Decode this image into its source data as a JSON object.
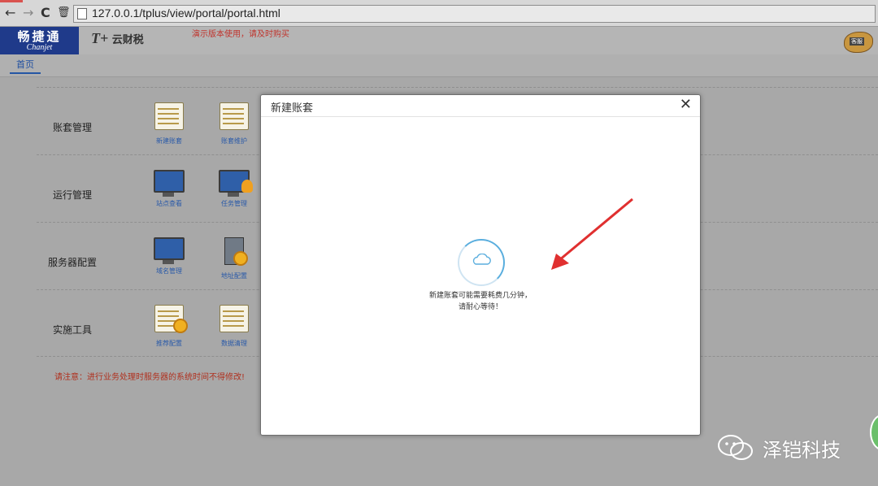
{
  "browser": {
    "url": "127.0.0.1/tplus/view/portal/portal.html",
    "back": "←",
    "forward": "→",
    "reload": "C",
    "trash": "🗑"
  },
  "header": {
    "brand_main": "畅捷通",
    "brand_sub": "Chanjet",
    "product_logo": "T+",
    "product_name": "云财税",
    "demo_notice": "演示版本使用，请及时购买",
    "mascot_badge": "客服"
  },
  "tabs": {
    "home": "首页"
  },
  "sections": [
    {
      "title": "账套管理",
      "tiles": [
        "新建账套",
        "账套维护"
      ]
    },
    {
      "title": "运行管理",
      "tiles": [
        "站点查看",
        "任务管理"
      ]
    },
    {
      "title": "服务器配置",
      "tiles": [
        "域名管理",
        "地址配置"
      ]
    },
    {
      "title": "实施工具",
      "tiles": [
        "推荐配置",
        "数据清理"
      ]
    }
  ],
  "notice": "请注意：进行业务处理时服务器的系统时间不得修改!",
  "modal": {
    "title": "新建账套",
    "close": "✕",
    "message_line1": "新建账套可能需要耗费几分钟，",
    "message_line2": "请耐心等待！"
  },
  "watermark": {
    "text": "泽铠科技"
  },
  "colors": {
    "brand": "#1f3a8a",
    "notice_red": "#c0322b",
    "arrow_red": "#e03030",
    "spinner_blue": "#5aaede"
  }
}
